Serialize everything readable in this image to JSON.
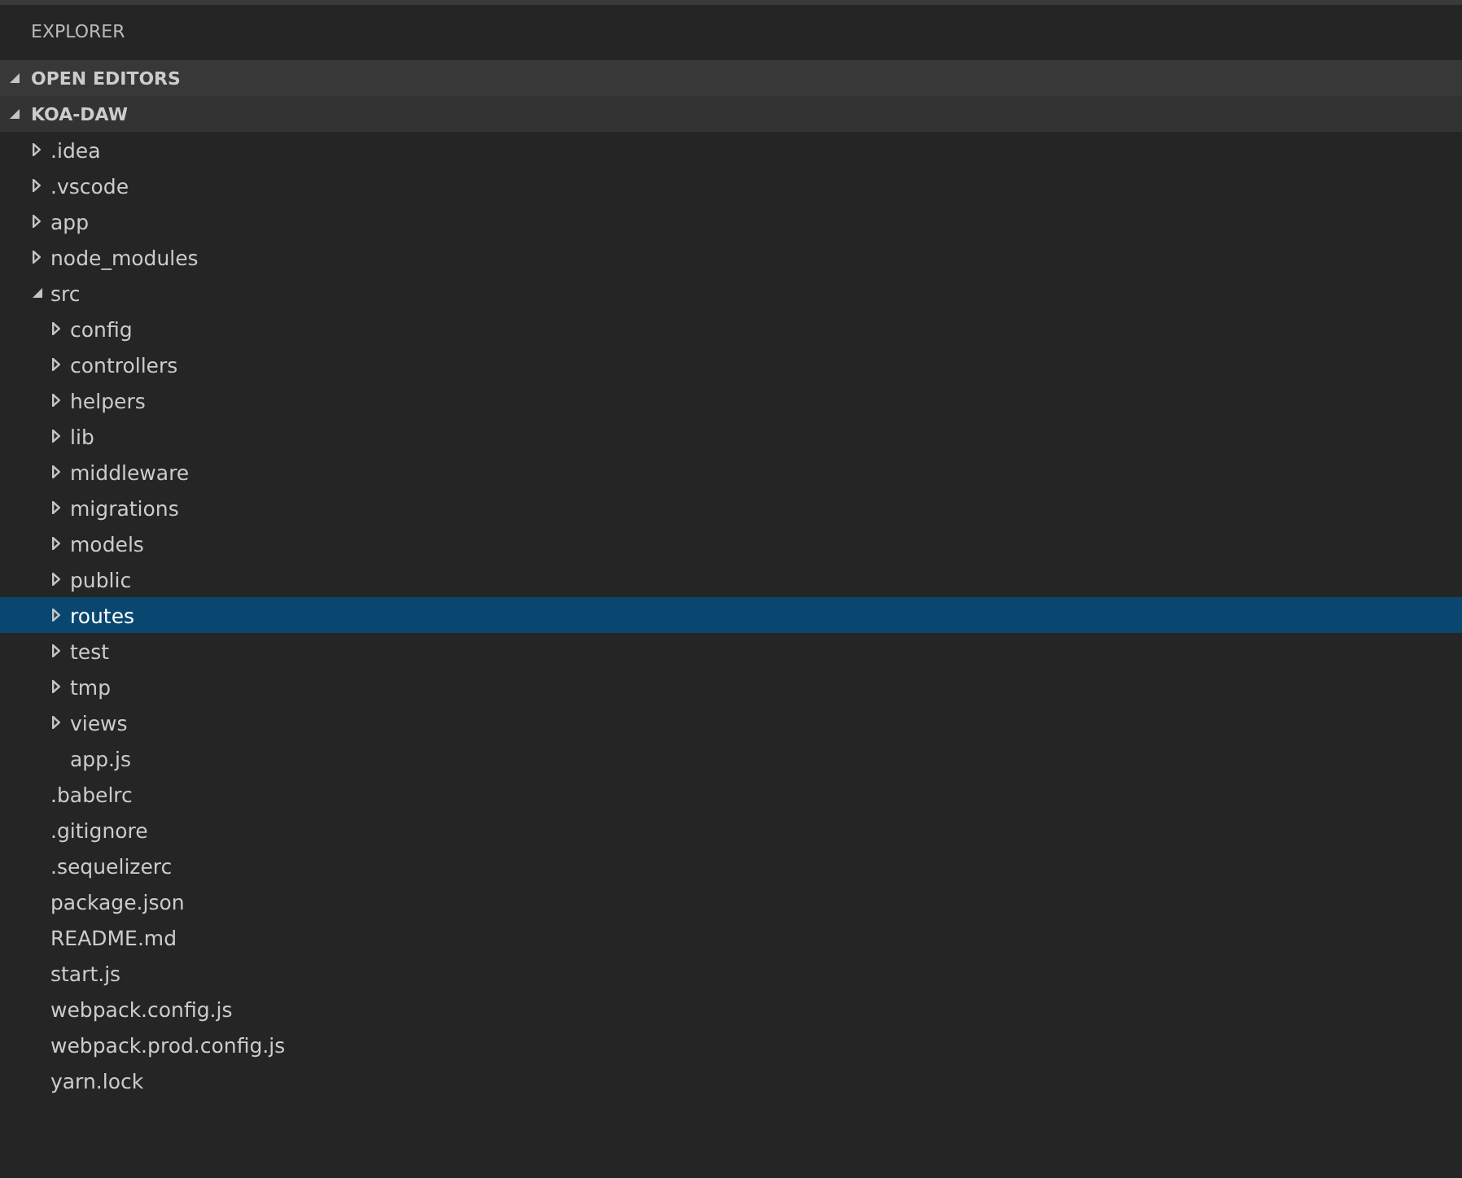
{
  "panel": {
    "title": "EXPLORER"
  },
  "sections": [
    {
      "title": "OPEN EDITORS",
      "expanded": true
    },
    {
      "title": "KOA-DAW",
      "expanded": true,
      "items": [
        {
          "label": ".idea",
          "kind": "folder",
          "expanded": false,
          "selected": false
        },
        {
          "label": ".vscode",
          "kind": "folder",
          "expanded": false,
          "selected": false
        },
        {
          "label": "app",
          "kind": "folder",
          "expanded": false,
          "selected": false
        },
        {
          "label": "node_modules",
          "kind": "folder",
          "expanded": false,
          "selected": false
        },
        {
          "label": "src",
          "kind": "folder",
          "expanded": true,
          "selected": false,
          "children": [
            {
              "label": "config",
              "kind": "folder",
              "expanded": false,
              "selected": false
            },
            {
              "label": "controllers",
              "kind": "folder",
              "expanded": false,
              "selected": false
            },
            {
              "label": "helpers",
              "kind": "folder",
              "expanded": false,
              "selected": false
            },
            {
              "label": "lib",
              "kind": "folder",
              "expanded": false,
              "selected": false
            },
            {
              "label": "middleware",
              "kind": "folder",
              "expanded": false,
              "selected": false
            },
            {
              "label": "migrations",
              "kind": "folder",
              "expanded": false,
              "selected": false
            },
            {
              "label": "models",
              "kind": "folder",
              "expanded": false,
              "selected": false
            },
            {
              "label": "public",
              "kind": "folder",
              "expanded": false,
              "selected": false
            },
            {
              "label": "routes",
              "kind": "folder",
              "expanded": false,
              "selected": true
            },
            {
              "label": "test",
              "kind": "folder",
              "expanded": false,
              "selected": false
            },
            {
              "label": "tmp",
              "kind": "folder",
              "expanded": false,
              "selected": false
            },
            {
              "label": "views",
              "kind": "folder",
              "expanded": false,
              "selected": false
            },
            {
              "label": "app.js",
              "kind": "file",
              "selected": false
            }
          ]
        },
        {
          "label": ".babelrc",
          "kind": "file",
          "selected": false
        },
        {
          "label": ".gitignore",
          "kind": "file",
          "selected": false
        },
        {
          "label": ".sequelizerc",
          "kind": "file",
          "selected": false
        },
        {
          "label": "package.json",
          "kind": "file",
          "selected": false
        },
        {
          "label": "README.md",
          "kind": "file",
          "selected": false
        },
        {
          "label": "start.js",
          "kind": "file",
          "selected": false
        },
        {
          "label": "webpack.config.js",
          "kind": "file",
          "selected": false
        },
        {
          "label": "webpack.prod.config.js",
          "kind": "file",
          "selected": false
        },
        {
          "label": "yarn.lock",
          "kind": "file",
          "selected": false
        }
      ]
    }
  ]
}
